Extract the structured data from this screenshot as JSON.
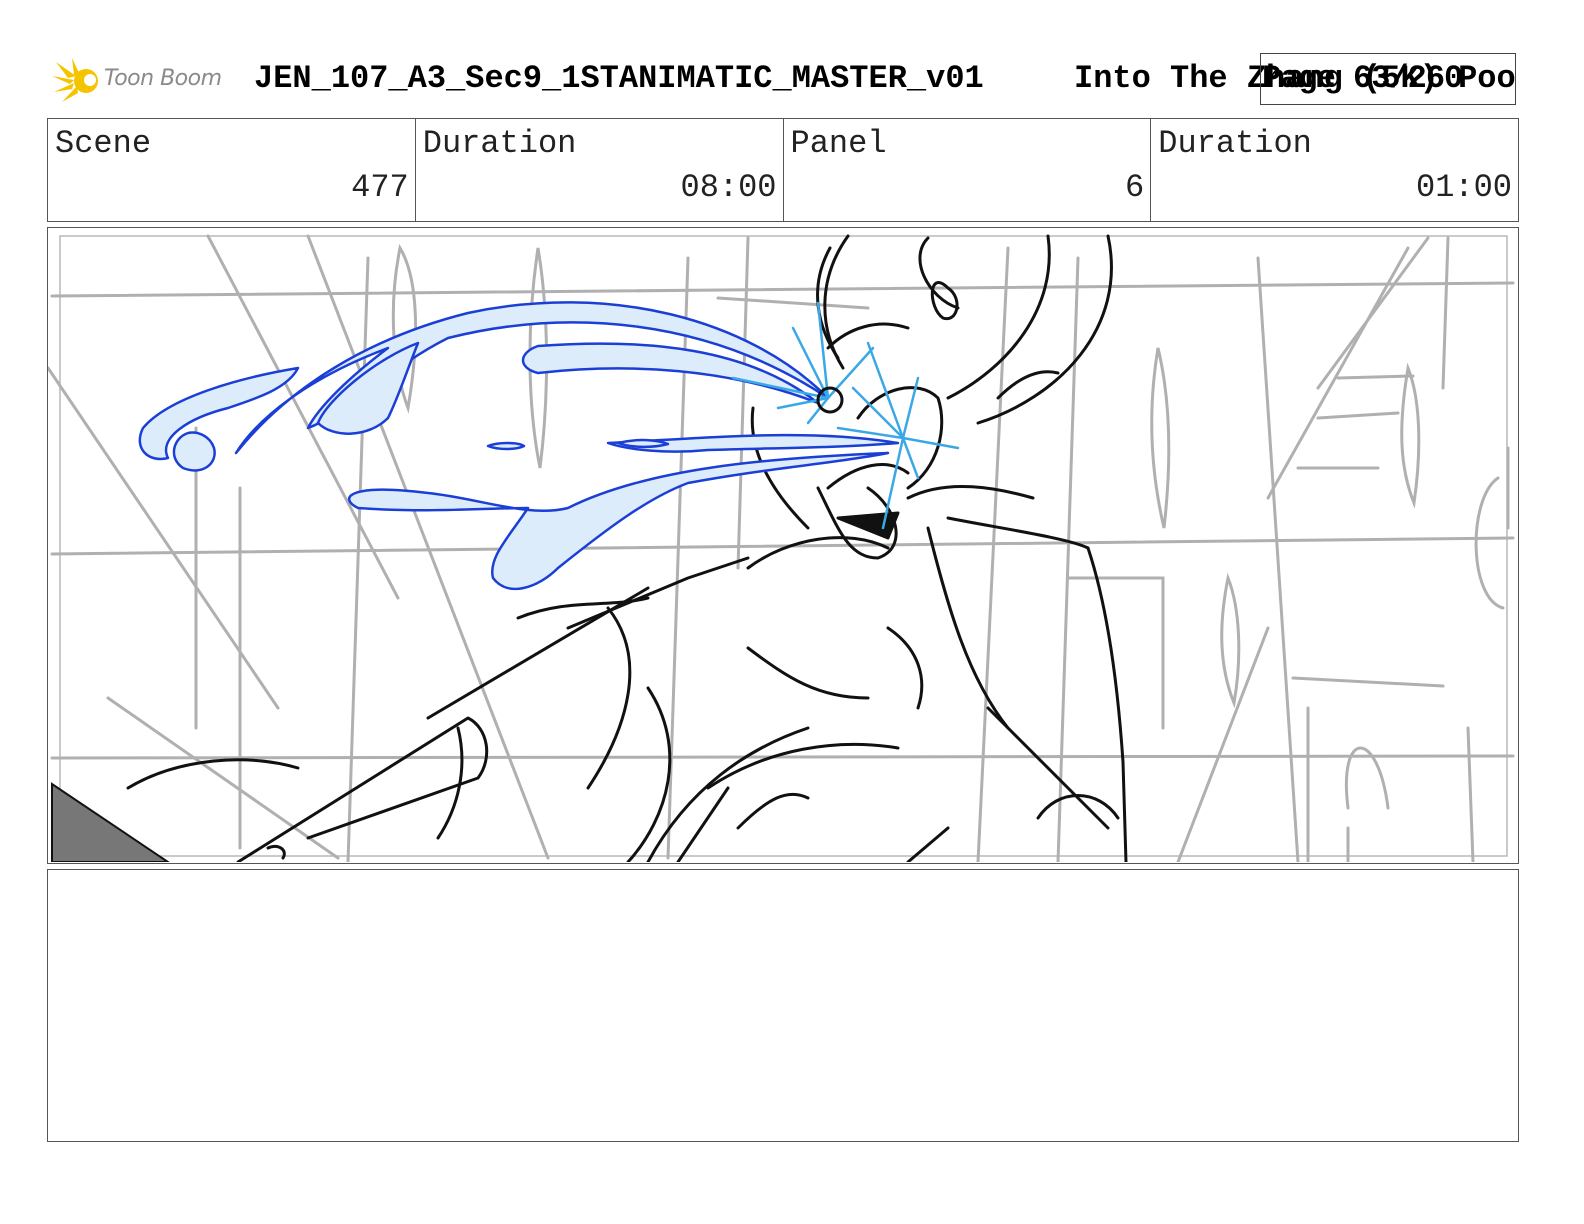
{
  "header": {
    "logo_text": "Toon Boom",
    "document_title": "JEN_107_A3_Sec9_1STANIMATIC_MASTER_v01",
    "show_title": "Into The Zhang (5K) Poo",
    "page_number": "Page 63/260"
  },
  "info": {
    "scene_label": "Scene",
    "scene_value": "477",
    "scene_duration_label": "Duration",
    "scene_duration_value": "08:00",
    "panel_label": "Panel",
    "panel_value": "6",
    "panel_duration_label": "Duration",
    "panel_duration_value": "01:00"
  },
  "colors": {
    "logo_flare": "#f5c400",
    "sketch_gray": "#b0b0b0",
    "ink_black": "#111111",
    "effect_blue": "#1b3fd6",
    "effect_fill": "#dcecfb",
    "spark_blue": "#3aa8e6"
  },
  "icons": {
    "logo": "toon-boom-flare-icon"
  }
}
